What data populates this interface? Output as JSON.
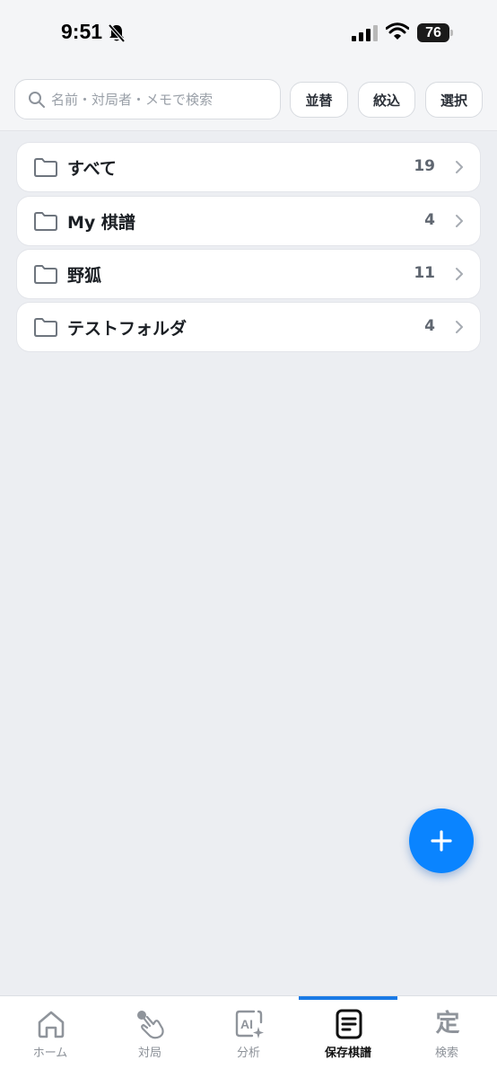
{
  "status_bar": {
    "time": "9:51",
    "battery": "76",
    "icons": [
      "mute-bell-icon",
      "cellular-signal-icon",
      "wifi-icon",
      "battery-icon"
    ]
  },
  "search": {
    "placeholder": "名前・対局者・メモで検索",
    "value": ""
  },
  "toolbar": {
    "sort_label": "並替",
    "filter_label": "絞込",
    "select_label": "選択"
  },
  "folders": [
    {
      "name": "すべて",
      "count": "19",
      "icon": "folder-icon"
    },
    {
      "name": "My 棋譜",
      "count": "4",
      "icon": "folder-icon"
    },
    {
      "name": "野狐",
      "count": "11",
      "icon": "folder-icon"
    },
    {
      "name": "テストフォルダ",
      "count": "4",
      "icon": "folder-icon"
    }
  ],
  "fab": {
    "icon": "plus-icon",
    "color": "#0a84ff"
  },
  "tabs": [
    {
      "label": "ホーム",
      "icon": "home-icon",
      "active": false
    },
    {
      "label": "対局",
      "icon": "tap-hand-icon",
      "active": false
    },
    {
      "label": "分析",
      "icon": "ai-sparkle-icon",
      "active": false
    },
    {
      "label": "保存棋譜",
      "icon": "document-icon",
      "active": true
    },
    {
      "label": "検索",
      "icon": "kanji-tei-icon",
      "glyph": "定",
      "active": false
    }
  ],
  "colors": {
    "accent": "#0a84ff",
    "tab_indicator": "#1a7ae6",
    "background": "#eceef2"
  }
}
